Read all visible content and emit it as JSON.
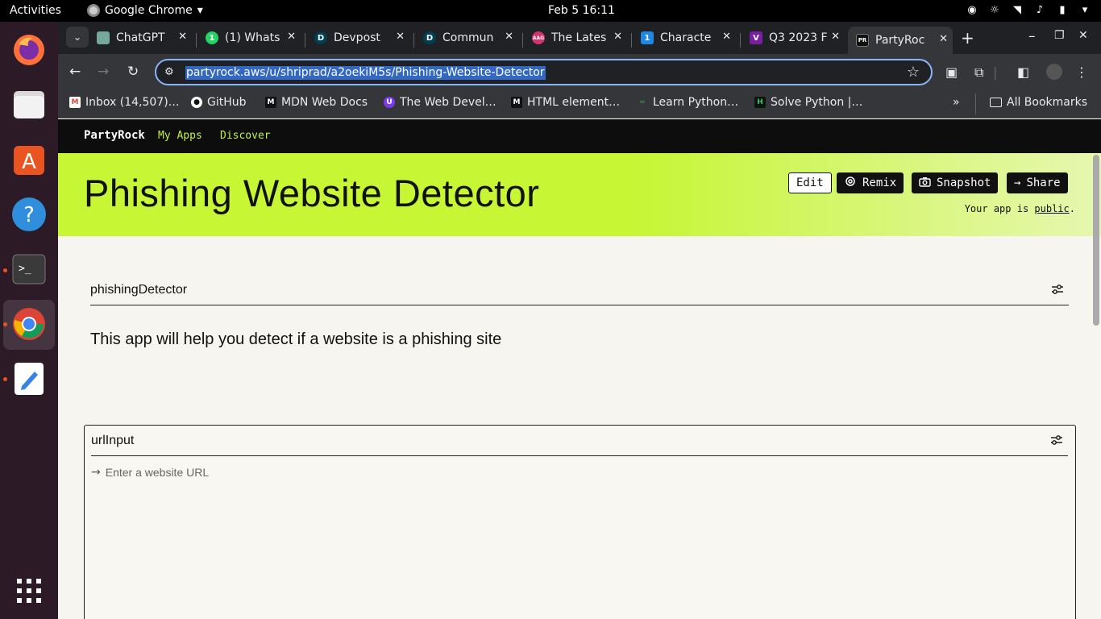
{
  "os": {
    "activities": "Activities",
    "app_name": "Google Chrome",
    "clock": "Feb 5  16:11"
  },
  "tabs": [
    {
      "label": "ChatGPT",
      "color": "#74aa9c",
      "glyph": ""
    },
    {
      "label": "(1) Whats",
      "color": "#25d366",
      "glyph": "1"
    },
    {
      "label": "Devpost",
      "color": "#003e54",
      "glyph": "D"
    },
    {
      "label": "Commun",
      "color": "#003e54",
      "glyph": "D"
    },
    {
      "label": "The Lates",
      "color": "#d6336c",
      "glyph": "AAG"
    },
    {
      "label": "Characte",
      "color": "#1e88e5",
      "glyph": "1"
    },
    {
      "label": "Q3 2023 F",
      "color": "#7b1fa2",
      "glyph": "V"
    },
    {
      "label": "PartyRoc",
      "color": "#111111",
      "glyph": "PR"
    }
  ],
  "address_bar": {
    "url": "partyrock.aws/u/shriprad/a2oekiM5s/Phishing-Website-Detector"
  },
  "bookmarks": [
    {
      "label": "Inbox (14,507)…",
      "icon": "gmail-icon"
    },
    {
      "label": "GitHub",
      "icon": "github-icon"
    },
    {
      "label": "MDN Web Docs",
      "icon": "mdn-icon"
    },
    {
      "label": "The Web Devel…",
      "icon": "webdev-icon"
    },
    {
      "label": "HTML element…",
      "icon": "mdn-icon"
    },
    {
      "label": "Learn Python…",
      "icon": "gfg-icon"
    },
    {
      "label": "Solve Python |…",
      "icon": "hackerrank-icon"
    }
  ],
  "all_bookmarks": "All Bookmarks",
  "partyrock": {
    "brand": "PartyRock",
    "nav": [
      "My Apps",
      "Discover"
    ],
    "title": "Phishing Website Detector",
    "buttons": {
      "edit": "Edit",
      "remix": "Remix",
      "snapshot": "Snapshot",
      "share": "Share"
    },
    "public_prefix": "Your app is ",
    "public_link": "public",
    "public_suffix": ".",
    "widgets": {
      "detector_name": "phishingDetector",
      "detector_text": "This app will help you detect if a website is a phishing site",
      "input_name": "urlInput",
      "input_placeholder": "Enter a website URL"
    }
  }
}
